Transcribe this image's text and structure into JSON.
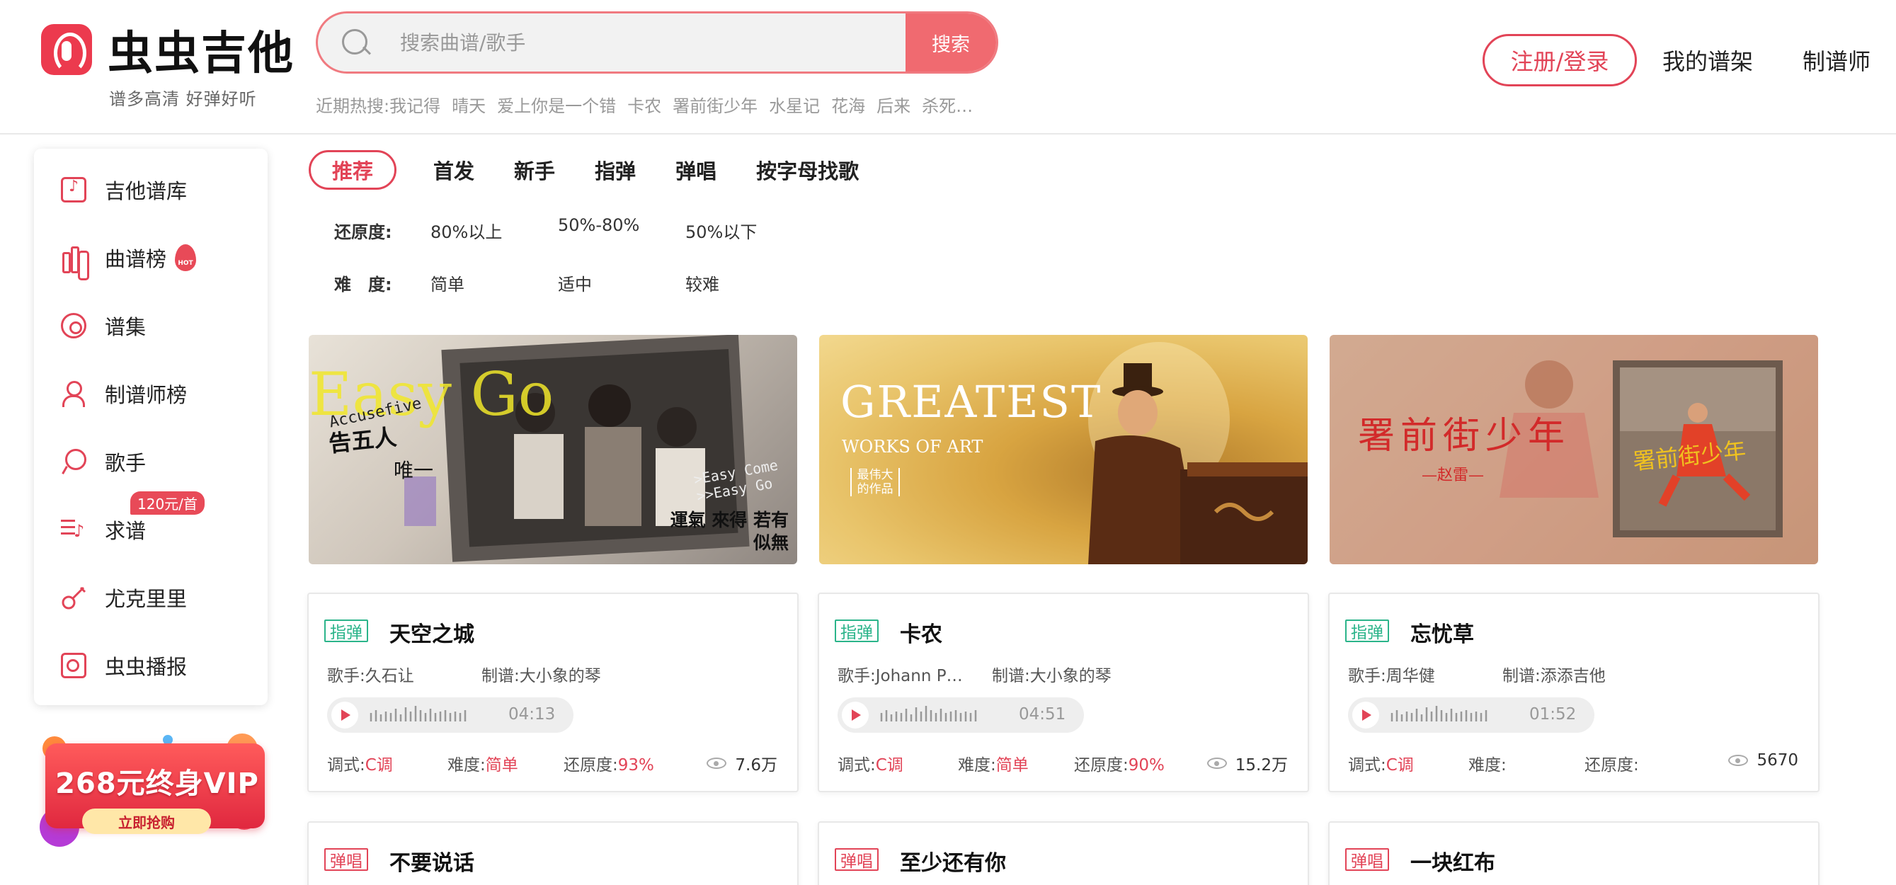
{
  "header": {
    "logo_text": "虫虫吉他",
    "slogan": "谱多高清 好弹好听",
    "search": {
      "placeholder": "搜索曲谱/歌手",
      "button": "搜索"
    },
    "hot_search_label": "近期热搜:",
    "hot_searches": [
      "我记得",
      "晴天",
      "爱上你是一个错",
      "卡农",
      "署前街少年",
      "水星记",
      "花海",
      "后来",
      "杀死…"
    ],
    "login": "注册/登录",
    "nav": [
      "我的谱架",
      "制谱师"
    ]
  },
  "sidebar": {
    "items": [
      {
        "label": "吉他谱库",
        "icon": "guitar-book-icon"
      },
      {
        "label": "曲谱榜",
        "icon": "chart-bars-icon",
        "badge": "HOT"
      },
      {
        "label": "谱集",
        "icon": "disc-icon"
      },
      {
        "label": "制谱师榜",
        "icon": "user-icon"
      },
      {
        "label": "歌手",
        "icon": "mic-icon"
      },
      {
        "label": "求谱",
        "icon": "music-list-icon",
        "price_badge": "120元/首"
      },
      {
        "label": "尤克里里",
        "icon": "ukulele-icon"
      },
      {
        "label": "虫虫播报",
        "icon": "news-icon"
      }
    ]
  },
  "vip": {
    "title": "268元终身VIP",
    "button": "立即抢购"
  },
  "tabs": [
    "推荐",
    "首发",
    "新手",
    "指弹",
    "弹唱",
    "按字母找歌"
  ],
  "filters": {
    "restore": {
      "label": "还原度:",
      "options": [
        "80%以上",
        "50%-80%",
        "50%以下"
      ]
    },
    "difficulty": {
      "label": "难　度:",
      "options": [
        "简单",
        "适中",
        "较难"
      ]
    }
  },
  "banners": [
    {
      "text1": "Easy Go",
      "text2": "Accusefive",
      "text3": "告五人",
      "text4": "唯一",
      "text5": ">Easy Come >>Easy Go",
      "text6": "運氣 來得 若有似無"
    },
    {
      "text1": "GREATEST",
      "text2": "WORKS OF ART",
      "text3": "最伟大的作品"
    },
    {
      "text1": "署前街少年",
      "text2": "—赵雷—",
      "text3": "署前街少年"
    }
  ],
  "cards": [
    {
      "tag": "指弹",
      "tag_color": "#2bb48a",
      "title": "天空之城",
      "artist_label": "歌手:",
      "artist": "久石让",
      "maker_label": "制谱:",
      "maker": "大小象的琴",
      "duration": "04:13",
      "key_label": "调式:",
      "key": "C调",
      "diff_label": "难度:",
      "diff": "简单",
      "restore_label": "还原度:",
      "restore": "93%",
      "views": "7.6万"
    },
    {
      "tag": "指弹",
      "tag_color": "#2bb48a",
      "title": "卡农",
      "artist_label": "歌手:",
      "artist": "Johann P…",
      "maker_label": "制谱:",
      "maker": "大小象的琴",
      "duration": "04:51",
      "key_label": "调式:",
      "key": "C调",
      "diff_label": "难度:",
      "diff": "简单",
      "restore_label": "还原度:",
      "restore": "90%",
      "views": "15.2万"
    },
    {
      "tag": "指弹",
      "tag_color": "#2bb48a",
      "title": "忘忧草",
      "artist_label": "歌手:",
      "artist": "周华健",
      "maker_label": "制谱:",
      "maker": "添添吉他",
      "duration": "01:52",
      "key_label": "调式:",
      "key": "C调",
      "diff_label": "难度:",
      "diff": "",
      "restore_label": "还原度:",
      "restore": "",
      "views": "5670"
    },
    {
      "tag": "弹唱",
      "tag_color": "#e24457",
      "title": "不要说话"
    },
    {
      "tag": "弹唱",
      "tag_color": "#e24457",
      "title": "至少还有你"
    },
    {
      "tag": "弹唱",
      "tag_color": "#e24457",
      "title": "一块红布"
    }
  ],
  "colors": {
    "accent": "#e24457",
    "search_btn": "#f06a70",
    "green_tag": "#2bb48a"
  }
}
